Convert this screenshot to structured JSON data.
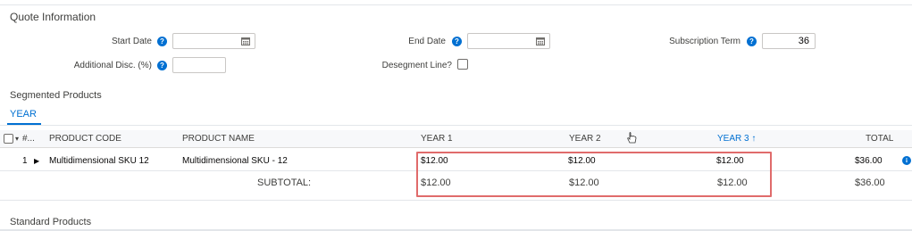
{
  "quote": {
    "section_title": "Quote Information",
    "start_date_label": "Start Date",
    "end_date_label": "End Date",
    "subscription_term_label": "Subscription Term",
    "subscription_term_value": "36",
    "additional_disc_label": "Additional Disc. (%)",
    "desegment_label": "Desegment Line?",
    "help_glyph": "?"
  },
  "segmented": {
    "title": "Segmented Products",
    "tab_label": "YEAR",
    "columns": {
      "rownum": "#...",
      "product_code": "PRODUCT CODE",
      "product_name": "PRODUCT NAME",
      "year1": "YEAR 1",
      "year2": "YEAR 2",
      "year3": "YEAR 3 ↑",
      "total": "TOTAL"
    },
    "rows": [
      {
        "num": "1",
        "expand": "▶",
        "product_code": "Multidimensional SKU 12",
        "product_name": "Multidimensional SKU - 12",
        "year1": "$12.00",
        "year2": "$12.00",
        "year3": "$12.00",
        "total": "$36.00"
      }
    ],
    "subtotal": {
      "label": "SUBTOTAL:",
      "year1": "$12.00",
      "year2": "$12.00",
      "year3": "$12.00",
      "total": "$36.00"
    }
  },
  "standard": {
    "title": "Standard Products"
  },
  "colors": {
    "accent": "#0070d2",
    "highlight": "#e06b6b"
  }
}
